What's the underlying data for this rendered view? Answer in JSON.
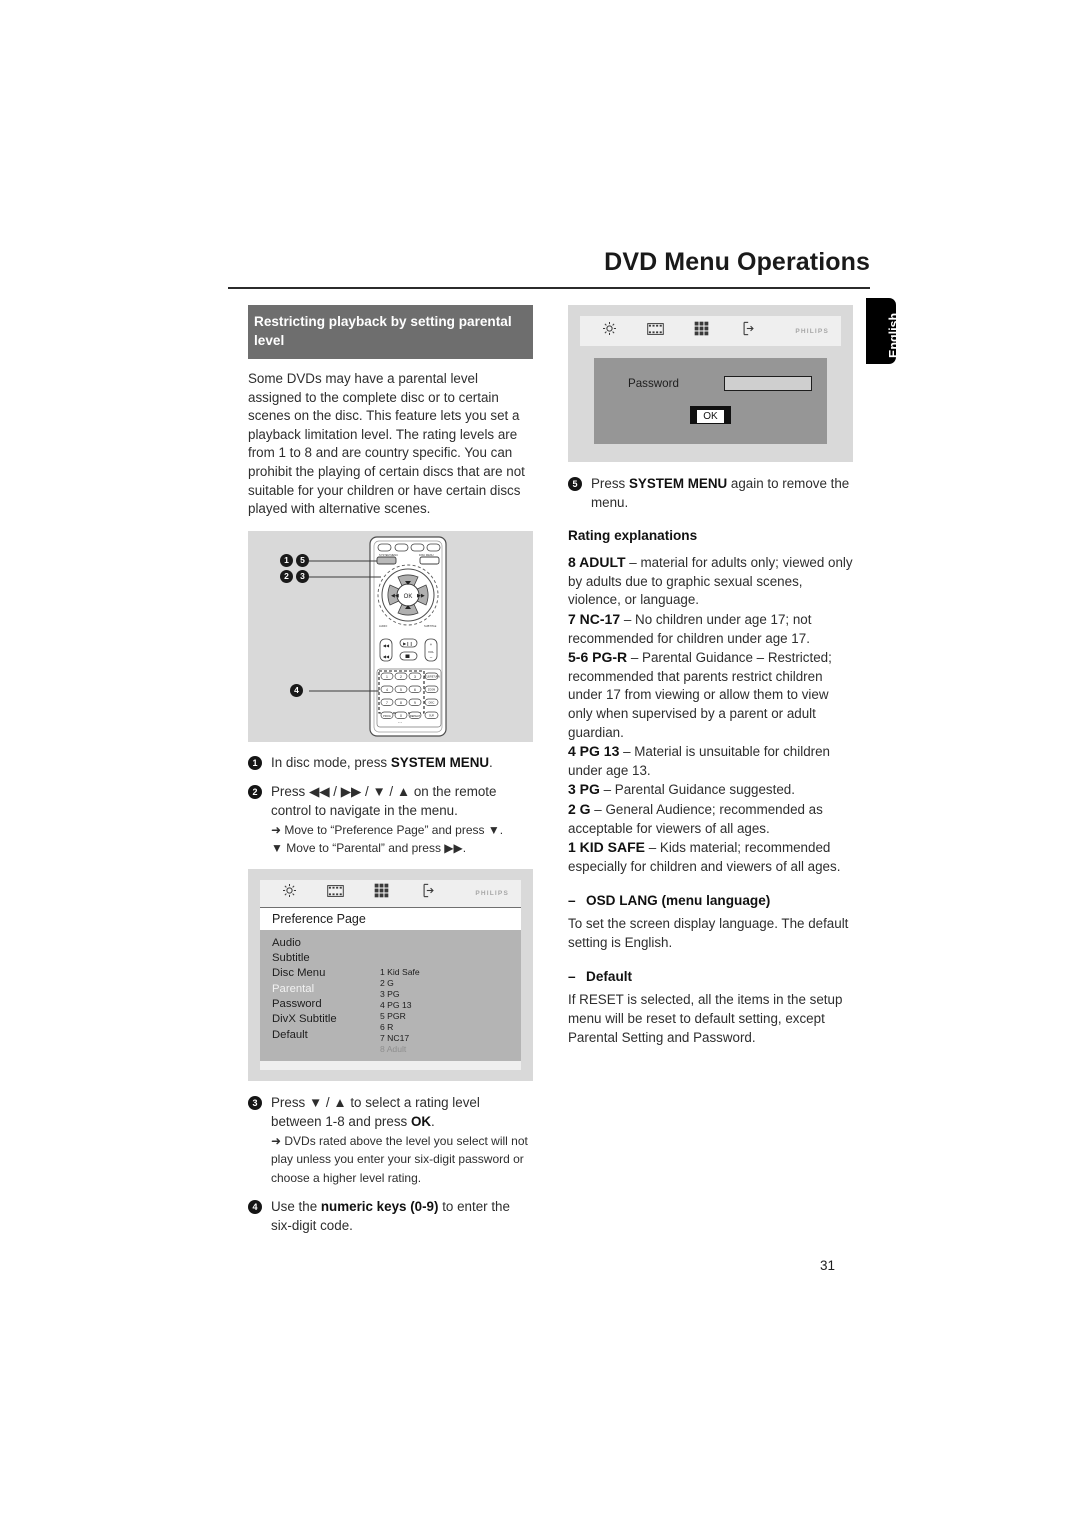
{
  "header": {
    "title": "DVD Menu Operations",
    "language_tab": "English"
  },
  "page_number": "31",
  "left_column": {
    "section_heading": "Restricting playback by setting parental level",
    "intro": "Some DVDs may have a parental level assigned to the complete disc or to certain scenes on the disc. This feature lets you set a playback limitation level. The rating levels are from 1 to 8 and are country specific. You can prohibit the playing of certain discs that are not suitable for your children or have certain discs played with alternative scenes.",
    "remote_callouts": [
      "1",
      "5",
      "2",
      "3",
      "4"
    ],
    "steps": [
      {
        "number": "1",
        "text_before": "In disc mode, press ",
        "bold": "SYSTEM MENU",
        "text_after": "."
      },
      {
        "number": "2",
        "text_before": "Press ◀◀ / ▶▶ / ▼ / ▲ on the remote control to navigate in the menu.",
        "bold": "",
        "text_after": "",
        "sub_lines": [
          "➜ Move to “Preference Page” and press ▼.",
          "▼ Move to “Parental” and press ▶▶."
        ]
      },
      {
        "number": "3",
        "text_before": "Press ▼ / ▲ to select a rating level between 1-8 and press ",
        "bold": "OK",
        "text_after": ".",
        "sub_lines": [
          "➜ DVDs rated above the level you select will not play unless you enter your six-digit password or choose a higher level rating."
        ]
      },
      {
        "number": "4",
        "text_before": "Use the ",
        "bold": "numeric keys (0-9)",
        "text_after": " to enter the six-digit code."
      }
    ],
    "osd_preference": {
      "brand": "PHILIPS",
      "icons": [
        "gear-sun-icon",
        "film-strip-icon",
        "grid-icon",
        "exit-arrow-icon"
      ],
      "title": "Preference Page",
      "menu_items": [
        {
          "label": "Audio",
          "selected": false
        },
        {
          "label": "Subtitle",
          "selected": false
        },
        {
          "label": "Disc Menu",
          "selected": false
        },
        {
          "label": "Parental",
          "selected": true
        },
        {
          "label": "Password",
          "selected": false
        },
        {
          "label": "DivX Subtitle",
          "selected": false
        },
        {
          "label": "Default",
          "selected": false
        }
      ],
      "rating_options": [
        {
          "label": "1 Kid Safe",
          "dim": false
        },
        {
          "label": "2 G",
          "dim": false
        },
        {
          "label": "3 PG",
          "dim": false
        },
        {
          "label": "4 PG 13",
          "dim": false
        },
        {
          "label": "5 PGR",
          "dim": false
        },
        {
          "label": "6 R",
          "dim": false
        },
        {
          "label": "7 NC17",
          "dim": false
        },
        {
          "label": "8 Adult",
          "dim": true
        }
      ]
    }
  },
  "right_column": {
    "osd_password": {
      "brand": "PHILIPS",
      "icons": [
        "gear-sun-icon",
        "film-strip-icon",
        "grid-icon",
        "exit-arrow-icon"
      ],
      "label": "Password",
      "input_value": "",
      "ok_label": "OK"
    },
    "step5": {
      "number": "5",
      "text_before": "Press ",
      "bold": "SYSTEM MENU",
      "text_after": " again to remove the menu."
    },
    "rating_explanations_heading": "Rating explanations",
    "ratings": [
      {
        "code": "8 ADULT",
        "desc": " – material for adults only; viewed only by adults due to graphic sexual scenes, violence, or language."
      },
      {
        "code": "7 NC-17",
        "desc": " – No children under age 17; not recommended for children under age 17."
      },
      {
        "code": "5-6 PG-R",
        "desc": " – Parental Guidance – Restricted; recommended that parents restrict children under 17 from viewing or allow them to view only when supervised by a parent or adult guardian."
      },
      {
        "code": "4 PG 13",
        "desc": " – Material is unsuitable for children under age 13."
      },
      {
        "code": "3 PG",
        "desc": " – Parental Guidance suggested."
      },
      {
        "code": "2 G",
        "desc": " – General Audience; recommended as acceptable for viewers of all ages."
      },
      {
        "code": "1 KID SAFE",
        "desc": " – Kids material; recommended especially for children and viewers of all ages."
      }
    ],
    "osd_lang": {
      "dash": "–",
      "heading": "OSD LANG (menu language)",
      "body": "To set the screen display language. The default setting is English."
    },
    "default_section": {
      "dash": "–",
      "heading": "Default",
      "body": "If RESET is selected, all the items in the setup menu will be reset to default setting,  except Parental Setting and Password."
    }
  }
}
